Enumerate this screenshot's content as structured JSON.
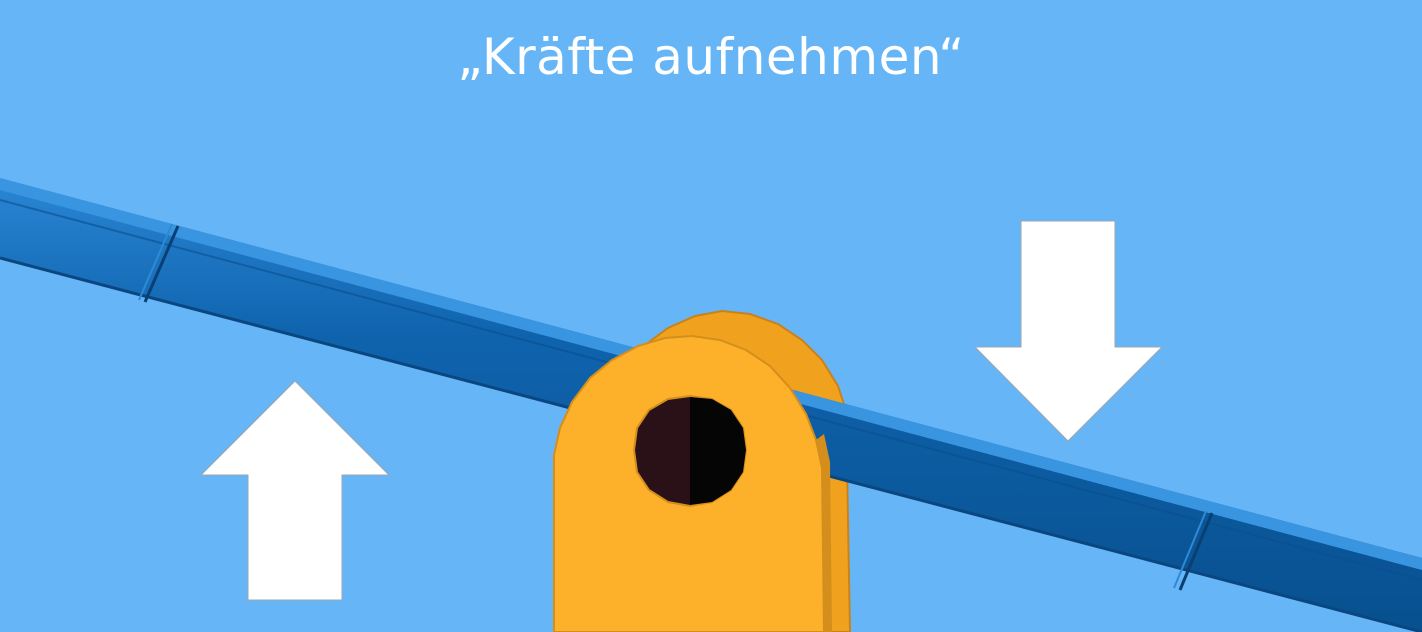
{
  "title": "„Kräfte aufnehmen“",
  "colors": {
    "background": "#66b6f7",
    "beam": "#0f63ad",
    "bracket": "#fdb02a",
    "arrow": "#ffffff",
    "pin": "#2a1118"
  },
  "arrows": [
    {
      "direction": "up"
    },
    {
      "direction": "down"
    }
  ]
}
